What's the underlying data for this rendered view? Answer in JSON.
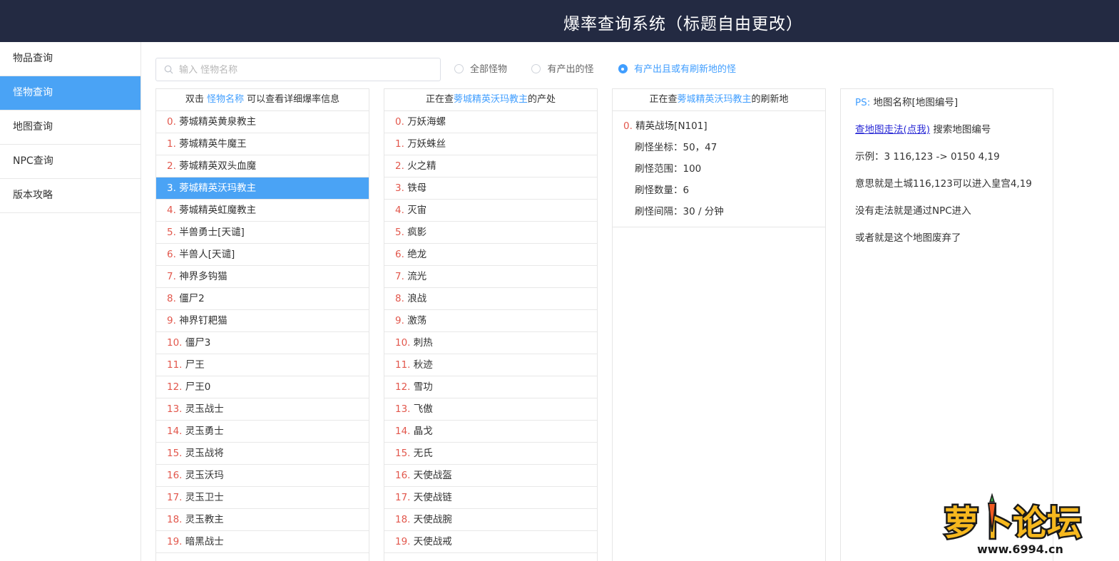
{
  "header": {
    "title": "爆率查询系统（标题自由更改）"
  },
  "sidebar": {
    "items": [
      {
        "label": "物品查询",
        "active": false
      },
      {
        "label": "怪物查询",
        "active": true
      },
      {
        "label": "地图查询",
        "active": false
      },
      {
        "label": "NPC查询",
        "active": false
      },
      {
        "label": "版本攻略",
        "active": false
      }
    ]
  },
  "search": {
    "placeholder": "输入 怪物名称",
    "value": ""
  },
  "filters": {
    "options": [
      "全部怪物",
      "有产出的怪",
      "有产出且或有刷新地的怪"
    ],
    "selected": "有产出且或有刷新地的怪"
  },
  "monster_panel": {
    "header_prefix": "双击 ",
    "header_link": "怪物名称",
    "header_suffix": " 可以查看详细爆率信息",
    "selected_index": 3,
    "items": [
      {
        "idx": "0.",
        "name": "蒡城精英黄泉教主"
      },
      {
        "idx": "1.",
        "name": "蒡城精英牛魔王"
      },
      {
        "idx": "2.",
        "name": "蒡城精英双头血魔"
      },
      {
        "idx": "3.",
        "name": "蒡城精英沃玛教主"
      },
      {
        "idx": "4.",
        "name": "蒡城精英虹魔教主"
      },
      {
        "idx": "5.",
        "name": "半兽勇士[天谴]"
      },
      {
        "idx": "6.",
        "name": "半兽人[天谴]"
      },
      {
        "idx": "7.",
        "name": "神界多钩猫"
      },
      {
        "idx": "8.",
        "name": "僵尸2"
      },
      {
        "idx": "9.",
        "name": "神界钉耙猫"
      },
      {
        "idx": "10.",
        "name": "僵尸3"
      },
      {
        "idx": "11.",
        "name": "尸王"
      },
      {
        "idx": "12.",
        "name": "尸王0"
      },
      {
        "idx": "13.",
        "name": "灵玉战士"
      },
      {
        "idx": "14.",
        "name": "灵玉勇士"
      },
      {
        "idx": "15.",
        "name": "灵玉战将"
      },
      {
        "idx": "16.",
        "name": "灵玉沃玛"
      },
      {
        "idx": "17.",
        "name": "灵玉卫士"
      },
      {
        "idx": "18.",
        "name": "灵玉教主"
      },
      {
        "idx": "19.",
        "name": "暗黑战士"
      }
    ]
  },
  "drops_panel": {
    "header_prefix": "正在查",
    "header_name": "蒡城精英沃玛教主",
    "header_suffix": "的产处",
    "items": [
      {
        "idx": "0.",
        "name": "万妖海螺"
      },
      {
        "idx": "1.",
        "name": "万妖蛛丝"
      },
      {
        "idx": "2.",
        "name": "火之精"
      },
      {
        "idx": "3.",
        "name": "铁母"
      },
      {
        "idx": "4.",
        "name": "灭宙"
      },
      {
        "idx": "5.",
        "name": "疯影"
      },
      {
        "idx": "6.",
        "name": "绝龙"
      },
      {
        "idx": "7.",
        "name": "流光"
      },
      {
        "idx": "8.",
        "name": "浪战"
      },
      {
        "idx": "9.",
        "name": "激荡"
      },
      {
        "idx": "10.",
        "name": "刺热"
      },
      {
        "idx": "11.",
        "name": "秋迹"
      },
      {
        "idx": "12.",
        "name": "雪功"
      },
      {
        "idx": "13.",
        "name": "飞傲"
      },
      {
        "idx": "14.",
        "name": "晶戈"
      },
      {
        "idx": "15.",
        "name": "无氏"
      },
      {
        "idx": "16.",
        "name": "天使战盔"
      },
      {
        "idx": "17.",
        "name": "天使战链"
      },
      {
        "idx": "18.",
        "name": "天使战腕"
      },
      {
        "idx": "19.",
        "name": "天使战戒"
      }
    ]
  },
  "refresh_panel": {
    "header_prefix": "正在查",
    "header_name": "蒡城精英沃玛教主",
    "header_suffix": "的刷新地",
    "entries": [
      {
        "idx": "0.",
        "map": "精英战场[N101]",
        "coord": "刷怪坐标：50，47",
        "range": "刷怪范围：100",
        "count": "刷怪数量：6",
        "interval": "刷怪间隔：30 / 分钟"
      }
    ]
  },
  "info_panel": {
    "ps_label": "PS:",
    "ps_text": " 地图名称[地图编号]",
    "link_text": "查地图走法(点我)",
    "link_suffix": " 搜索地图编号",
    "example": "示例：3 116,123 -> 0150 4,19",
    "meaning": "意思就是土城116,123可以进入皇宫4,19",
    "no_route": "没有走法就是通过NPC进入",
    "abandoned": "或者就是这个地图废弃了"
  },
  "watermark": {
    "text": "萝卜论坛",
    "url": "www.6994.cn",
    "colors": {
      "fill": "#f6b81e",
      "outline": "#1a1a1a",
      "carrot": "#f05a22"
    }
  },
  "colors": {
    "header_bg": "#232a42",
    "accent": "#409eff",
    "selected_bg": "#4aa3f5",
    "index": "#e2574c"
  }
}
